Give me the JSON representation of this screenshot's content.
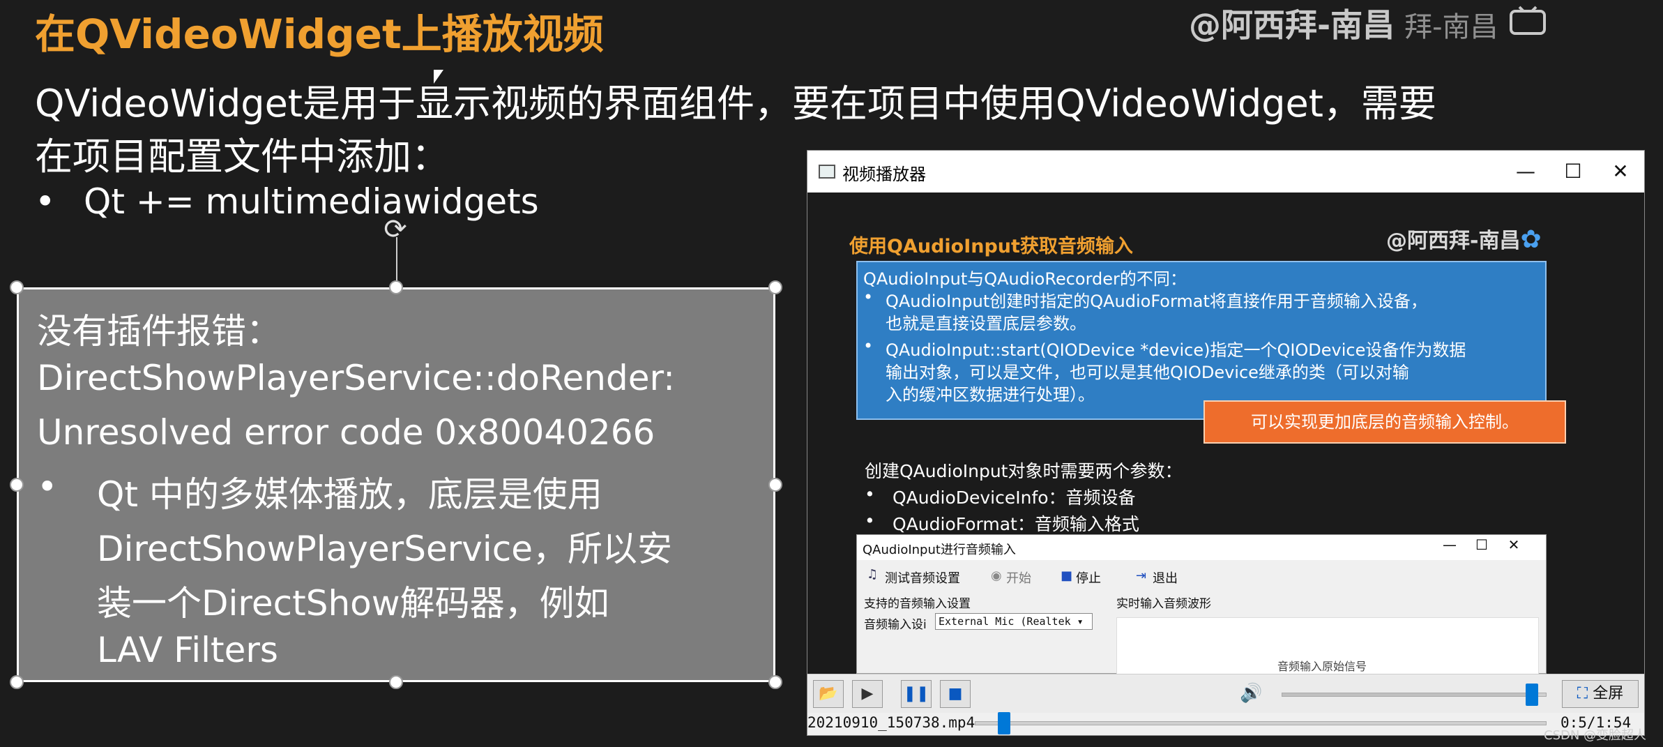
{
  "slide": {
    "title": "在QVideoWidget上播放视频",
    "watermark": "@阿西拜-南昌",
    "watermark_sub": "拜-南昌",
    "intro_line1": "QVideoWidget是用于显示视频的界面组件，要在项目中使用QVideoWidget，需要",
    "intro_line2": "在项目配置文件中添加：",
    "bullet1": "Qt += multimediawidgets",
    "bullet_dot": "•"
  },
  "errorbox": {
    "line1": "没有插件报错：",
    "line2": "DirectShowPlayerService::doRender:",
    "line3": "Unresolved error code 0x80040266",
    "bullet_line1": "Qt 中的多媒体播放，底层是使用",
    "bullet_line2": "DirectShowPlayerService，所以安",
    "bullet_line3": "装一个DirectShow解码器，例如",
    "bullet_line4": "LAV Filters"
  },
  "player": {
    "title": "视频播放器",
    "video": {
      "heading": "使用QAudioInput获取音频输入",
      "watermark": "@阿西拜-南昌",
      "bluebox": {
        "line1": "QAudioInput与QAudioRecorder的不同：",
        "b1_line1": "QAudioInput创建时指定的QAudioFormat将直接作用于音频输入设备，",
        "b1_line2": "也就是直接设置底层参数。",
        "b2_line1": "QAudioInput::start(QIODevice *device)指定一个QIODevice设备作为数据",
        "b2_line2": "输出对象，可以是文件，也可以是其他QIODevice继承的类（可以对输",
        "b2_line3": "入的缓冲区数据进行处理）。"
      },
      "orange_note": "可以实现更加底层的音频输入控制。",
      "params_intro": "创建QAudioInput对象时需要两个参数：",
      "param1": "QAudioDeviceInfo：音频设备",
      "param2": "QAudioFormat：音频输入格式",
      "inner_window": {
        "title": "QAudioInput进行音频输入",
        "toolbar": {
          "test": "测试音频设置",
          "start": "开始",
          "stop": "停止",
          "exit": "退出"
        },
        "group_left": "支持的音频输入设置",
        "group_right": "实时输入音频波形",
        "device_label": "音频输入设i",
        "device_value": "External Mic (Realtek",
        "wave_caption": "音频输入原始信号"
      }
    },
    "controls": {
      "fullscreen": "全屏",
      "volume_level": 0.97,
      "seek_level": 0.04
    },
    "status": {
      "filename": "20210910_150738.mp4",
      "timecode": "0:5/1:54"
    }
  },
  "footer": {
    "csdn": "CSDN @变脸超人"
  }
}
